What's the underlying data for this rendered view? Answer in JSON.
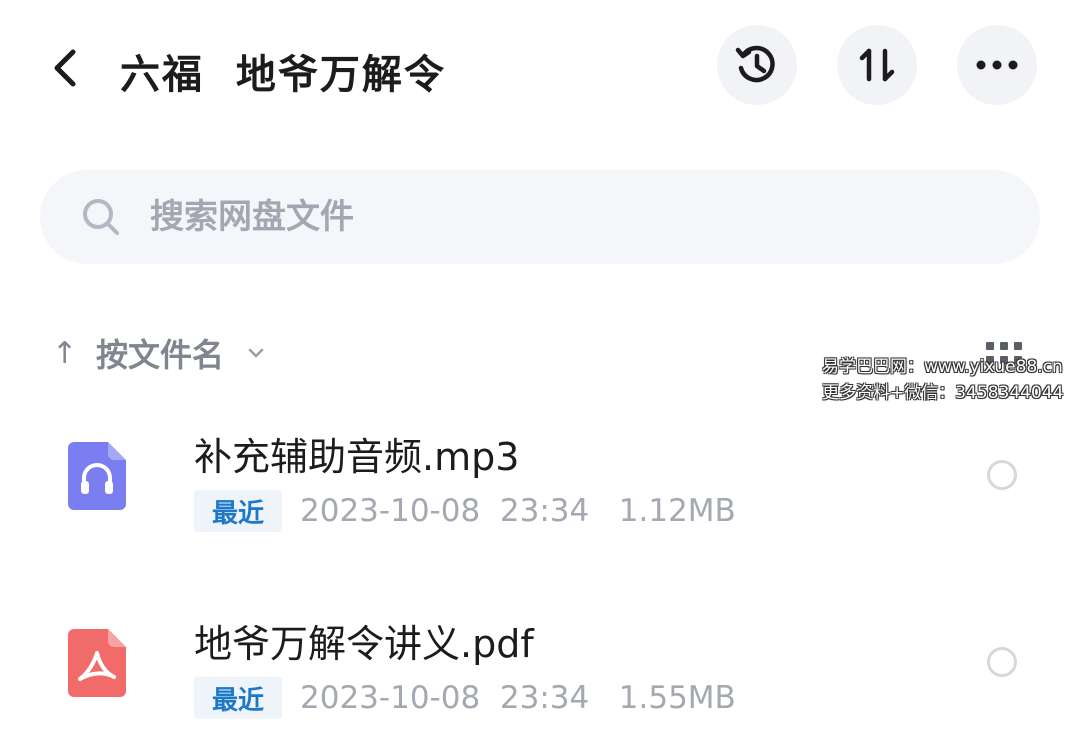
{
  "header": {
    "title": "六福  地爷万解令",
    "icons": {
      "back": "chevron-left-icon",
      "history": "history-clock-icon",
      "sort": "sort-arrows-icon",
      "more": "more-dots-icon"
    }
  },
  "search": {
    "placeholder": "搜索网盘文件",
    "icon": "search-icon"
  },
  "sort": {
    "arrow": "↑",
    "label": "按文件名",
    "chevron": "chevron-down-icon",
    "view_toggle": "grid-view-icon"
  },
  "watermark": {
    "line1": "易学巴巴网：www.yixue88.cn",
    "line2": "更多资料+微信：3458344044"
  },
  "files": [
    {
      "name": "补充辅助音频.mp3",
      "badge": "最近",
      "meta": "2023-10-08  23:34   1.12MB",
      "type": "audio",
      "icon": "audio-file-icon",
      "color": "#7b7ef0"
    },
    {
      "name": "地爷万解令讲义.pdf",
      "badge": "最近",
      "meta": "2023-10-08  23:34   1.55MB",
      "type": "pdf",
      "icon": "pdf-file-icon",
      "color": "#f26b6b"
    }
  ],
  "colors": {
    "accent": "#1e78c8",
    "badge_bg": "#eef4fa",
    "round_button_bg": "#f2f3f7",
    "search_bg": "#f4f6fa"
  }
}
